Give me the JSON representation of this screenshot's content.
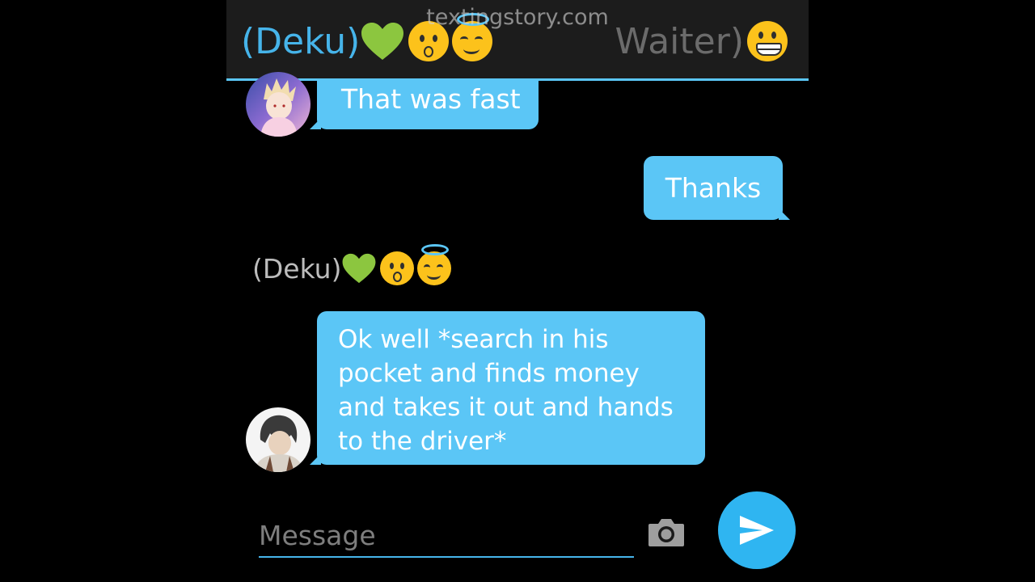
{
  "watermark": "textingstory.com",
  "header": {
    "left_name": "(Deku)",
    "left_emojis": [
      "green-heart-icon",
      "kissing-face-icon",
      "halo-smiling-face-icon"
    ],
    "right_name": "Waiter)",
    "right_emojis": [
      "grinning-face-icon"
    ]
  },
  "messages": [
    {
      "side": "left",
      "text": "That was fast",
      "avatar": "bakugo-avatar"
    },
    {
      "side": "right",
      "text": "Thanks"
    },
    {
      "side": "left",
      "sender": "(Deku)",
      "sender_emojis": [
        "green-heart-icon",
        "kissing-face-icon",
        "halo-smiling-face-icon"
      ],
      "text": "Ok well *search in his pocket and finds money and takes it out and hands to the driver*",
      "avatar": "dark-hair-avatar"
    }
  ],
  "composer": {
    "placeholder": "Message",
    "value": ""
  },
  "colors": {
    "accent": "#5bc6f6",
    "background": "#000000",
    "header_bg": "#1c1c1c",
    "send_button": "#2fb5f1",
    "left_name": "#46b4ea",
    "right_name": "#6b6b6b"
  }
}
